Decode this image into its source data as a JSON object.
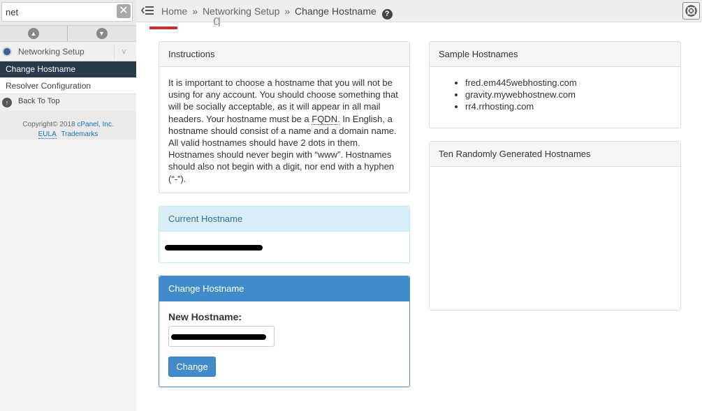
{
  "sidebar": {
    "search_value": "net",
    "clear_symbol": "✕",
    "up_symbol": "▲",
    "down_symbol": "▼",
    "group_label": "Networking Setup",
    "group_toggle_symbol": "v",
    "items": [
      {
        "label": "Change Hostname",
        "active": true
      },
      {
        "label": "Resolver Configuration",
        "active": false
      }
    ],
    "back_to_top": "Back To Top",
    "back_to_top_symbol": "↑",
    "footer": {
      "copyright_prefix": "Copyright© 2018 ",
      "copyright_link": "cPanel, Inc.",
      "eula": "EULA",
      "trademarks": "Trademarks"
    }
  },
  "topbar": {
    "breadcrumb": {
      "home": "Home",
      "separator": "»",
      "section": "Networking Setup",
      "current": "Change Hostname"
    },
    "help_symbol": "?",
    "menu_icon": "menu-collapse-icon",
    "support_icon": "life-ring-icon"
  },
  "page": {
    "title_glyph": "g"
  },
  "instructions": {
    "title": "Instructions",
    "text_before_abbr": "It is important to choose a hostname that you will not be using for any account. You should choose something that will be socially acceptable, as it will appear in all mail headers. Your hostname must be a ",
    "abbr": "FQDN",
    "text_after_abbr": ". In English, a hostname should consist of a name and a domain name. All valid hostnames should have 2 dots in them. Hostnames should never begin with “www”. Hostnames should also not begin with a digit, nor end with a hyphen (“-”)."
  },
  "current_hostname": {
    "title": "Current Hostname"
  },
  "change_hostname": {
    "title": "Change Hostname",
    "field_label": "New Hostname:",
    "button_label": "Change"
  },
  "samples": {
    "title": "Sample Hostnames",
    "items": [
      "fred.em445webhosting.com",
      "gravity.mywebhostnew.com",
      "rr4.rrhosting.com"
    ]
  },
  "random": {
    "title": "Ten Randomly Generated Hostnames"
  },
  "colors": {
    "nav_active_bg": "#293a4a",
    "primary": "#428bca",
    "info_bg": "#d9edf7",
    "accent_red": "#c9302c"
  }
}
